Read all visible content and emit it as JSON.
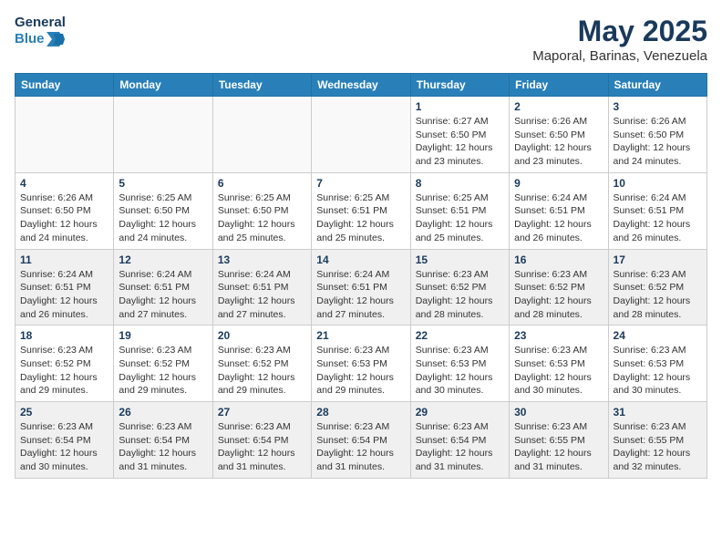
{
  "logo": {
    "line1": "General",
    "line2": "Blue"
  },
  "title": "May 2025",
  "location": "Maporal, Barinas, Venezuela",
  "weekdays": [
    "Sunday",
    "Monday",
    "Tuesday",
    "Wednesday",
    "Thursday",
    "Friday",
    "Saturday"
  ],
  "weeks": [
    [
      {
        "day": "",
        "info": ""
      },
      {
        "day": "",
        "info": ""
      },
      {
        "day": "",
        "info": ""
      },
      {
        "day": "",
        "info": ""
      },
      {
        "day": "1",
        "info": "Sunrise: 6:27 AM\nSunset: 6:50 PM\nDaylight: 12 hours\nand 23 minutes."
      },
      {
        "day": "2",
        "info": "Sunrise: 6:26 AM\nSunset: 6:50 PM\nDaylight: 12 hours\nand 23 minutes."
      },
      {
        "day": "3",
        "info": "Sunrise: 6:26 AM\nSunset: 6:50 PM\nDaylight: 12 hours\nand 24 minutes."
      }
    ],
    [
      {
        "day": "4",
        "info": "Sunrise: 6:26 AM\nSunset: 6:50 PM\nDaylight: 12 hours\nand 24 minutes."
      },
      {
        "day": "5",
        "info": "Sunrise: 6:25 AM\nSunset: 6:50 PM\nDaylight: 12 hours\nand 24 minutes."
      },
      {
        "day": "6",
        "info": "Sunrise: 6:25 AM\nSunset: 6:50 PM\nDaylight: 12 hours\nand 25 minutes."
      },
      {
        "day": "7",
        "info": "Sunrise: 6:25 AM\nSunset: 6:51 PM\nDaylight: 12 hours\nand 25 minutes."
      },
      {
        "day": "8",
        "info": "Sunrise: 6:25 AM\nSunset: 6:51 PM\nDaylight: 12 hours\nand 25 minutes."
      },
      {
        "day": "9",
        "info": "Sunrise: 6:24 AM\nSunset: 6:51 PM\nDaylight: 12 hours\nand 26 minutes."
      },
      {
        "day": "10",
        "info": "Sunrise: 6:24 AM\nSunset: 6:51 PM\nDaylight: 12 hours\nand 26 minutes."
      }
    ],
    [
      {
        "day": "11",
        "info": "Sunrise: 6:24 AM\nSunset: 6:51 PM\nDaylight: 12 hours\nand 26 minutes."
      },
      {
        "day": "12",
        "info": "Sunrise: 6:24 AM\nSunset: 6:51 PM\nDaylight: 12 hours\nand 27 minutes."
      },
      {
        "day": "13",
        "info": "Sunrise: 6:24 AM\nSunset: 6:51 PM\nDaylight: 12 hours\nand 27 minutes."
      },
      {
        "day": "14",
        "info": "Sunrise: 6:24 AM\nSunset: 6:51 PM\nDaylight: 12 hours\nand 27 minutes."
      },
      {
        "day": "15",
        "info": "Sunrise: 6:23 AM\nSunset: 6:52 PM\nDaylight: 12 hours\nand 28 minutes."
      },
      {
        "day": "16",
        "info": "Sunrise: 6:23 AM\nSunset: 6:52 PM\nDaylight: 12 hours\nand 28 minutes."
      },
      {
        "day": "17",
        "info": "Sunrise: 6:23 AM\nSunset: 6:52 PM\nDaylight: 12 hours\nand 28 minutes."
      }
    ],
    [
      {
        "day": "18",
        "info": "Sunrise: 6:23 AM\nSunset: 6:52 PM\nDaylight: 12 hours\nand 29 minutes."
      },
      {
        "day": "19",
        "info": "Sunrise: 6:23 AM\nSunset: 6:52 PM\nDaylight: 12 hours\nand 29 minutes."
      },
      {
        "day": "20",
        "info": "Sunrise: 6:23 AM\nSunset: 6:52 PM\nDaylight: 12 hours\nand 29 minutes."
      },
      {
        "day": "21",
        "info": "Sunrise: 6:23 AM\nSunset: 6:53 PM\nDaylight: 12 hours\nand 29 minutes."
      },
      {
        "day": "22",
        "info": "Sunrise: 6:23 AM\nSunset: 6:53 PM\nDaylight: 12 hours\nand 30 minutes."
      },
      {
        "day": "23",
        "info": "Sunrise: 6:23 AM\nSunset: 6:53 PM\nDaylight: 12 hours\nand 30 minutes."
      },
      {
        "day": "24",
        "info": "Sunrise: 6:23 AM\nSunset: 6:53 PM\nDaylight: 12 hours\nand 30 minutes."
      }
    ],
    [
      {
        "day": "25",
        "info": "Sunrise: 6:23 AM\nSunset: 6:54 PM\nDaylight: 12 hours\nand 30 minutes."
      },
      {
        "day": "26",
        "info": "Sunrise: 6:23 AM\nSunset: 6:54 PM\nDaylight: 12 hours\nand 31 minutes."
      },
      {
        "day": "27",
        "info": "Sunrise: 6:23 AM\nSunset: 6:54 PM\nDaylight: 12 hours\nand 31 minutes."
      },
      {
        "day": "28",
        "info": "Sunrise: 6:23 AM\nSunset: 6:54 PM\nDaylight: 12 hours\nand 31 minutes."
      },
      {
        "day": "29",
        "info": "Sunrise: 6:23 AM\nSunset: 6:54 PM\nDaylight: 12 hours\nand 31 minutes."
      },
      {
        "day": "30",
        "info": "Sunrise: 6:23 AM\nSunset: 6:55 PM\nDaylight: 12 hours\nand 31 minutes."
      },
      {
        "day": "31",
        "info": "Sunrise: 6:23 AM\nSunset: 6:55 PM\nDaylight: 12 hours\nand 32 minutes."
      }
    ]
  ]
}
